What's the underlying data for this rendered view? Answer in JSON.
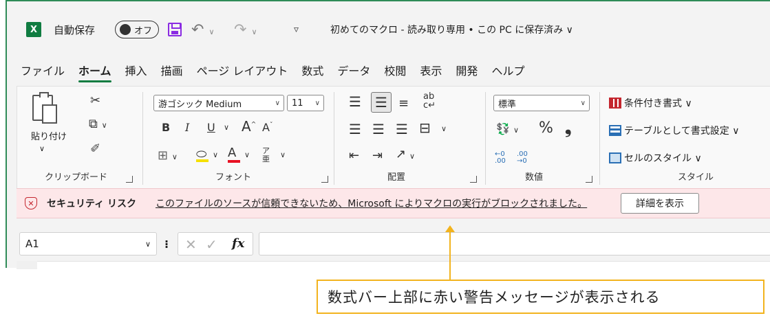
{
  "titlebar": {
    "app_icon": "X",
    "autosave_label": "自動保存",
    "autosave_state": "オフ",
    "qat_more": "▿",
    "doc_title": "初めてのマクロ - 読み取り専用 • この PC に保存済み ∨"
  },
  "tabs": [
    "ファイル",
    "ホーム",
    "挿入",
    "描画",
    "ページ レイアウト",
    "数式",
    "データ",
    "校閲",
    "表示",
    "開発",
    "ヘルプ"
  ],
  "active_tab": "ホーム",
  "ribbon": {
    "clipboard": {
      "paste_label": "貼り付け",
      "group_label": "クリップボード"
    },
    "font": {
      "font_name": "游ゴシック Medium",
      "font_size": "11",
      "bold": "B",
      "italic": "I",
      "underline": "U",
      "grow": "A",
      "shrink": "A",
      "font_color_letter": "A",
      "phonetic": "ア",
      "phonetic_sub": "亜",
      "group_label": "フォント"
    },
    "alignment": {
      "wrap": "ab",
      "wrap_sub": "c↵",
      "group_label": "配置"
    },
    "number": {
      "format": "標準",
      "percent": "%",
      "comma": "❟",
      "dec_inc": "←0 .00",
      "dec_dec": ".00 →0",
      "group_label": "数値"
    },
    "styles": {
      "conditional": "条件付き書式 ∨",
      "as_table": "テーブルとして書式設定 ∨",
      "cell_styles": "セルのスタイル ∨",
      "group_label": "スタイル"
    }
  },
  "security_bar": {
    "title": "セキュリティ リスク",
    "message": "このファイルのソースが信頼できないため、Microsoft によりマクロの実行がブロックされました。",
    "button": "詳細を表示"
  },
  "formula_bar": {
    "name_box": "A1",
    "fx": "fx",
    "formula": ""
  },
  "annotation": "数式バー上部に赤い警告メッセージが表示される",
  "colors": {
    "excel_green": "#107c41",
    "warning_bg": "#fde7e9",
    "warning_icon": "#c4262e",
    "annotation": "#f2b31d"
  }
}
